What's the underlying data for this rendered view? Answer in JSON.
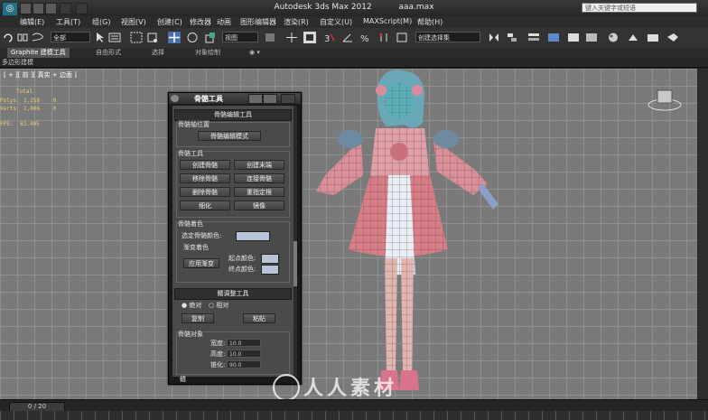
{
  "title_bar": {
    "app_title": "Autodesk 3ds Max  2012",
    "file_name": "aaa.max",
    "search_placeholder": "键入关键字或短语"
  },
  "menu": [
    "编辑(E)",
    "工具(T)",
    "组(G)",
    "视图(V)",
    "创建(C)",
    "修改器",
    "动画",
    "图形编辑器",
    "渲染(R)",
    "自定义(U)",
    "MAXScript(M)",
    "帮助(H)"
  ],
  "toolbar": {
    "selection_filter": "全部",
    "reference_coord": "视图",
    "named_selection": "创建选择集"
  },
  "ribbon": {
    "tabs": [
      "Graphite 建模工具",
      "自由形式",
      "选择",
      "对象绘制"
    ],
    "sub_label": "多边形建模"
  },
  "viewport": {
    "label": "[ + ][ 前 ][ 真实 + 边面 ]",
    "stats": [
      {
        "label": "Total",
        "value": ""
      },
      {
        "label": "Polys:",
        "value": "1,258    0"
      },
      {
        "label": "Verts:",
        "value": "1,006    0"
      },
      {
        "label": "FPS:",
        "value": "83.405"
      }
    ]
  },
  "bone_tools": {
    "title": "骨骼工具",
    "rollout_edit": "骨骼编辑工具",
    "group_pivot": "骨骼轴位置",
    "btn_edit_mode": "骨骼编辑模式",
    "group_tools": "骨骼工具",
    "btn_create_bone": "创建骨骼",
    "btn_create_end": "创建末端",
    "btn_remove_bone": "移除骨骼",
    "btn_connect_bone": "连接骨骼",
    "btn_delete_bone": "删除骨骼",
    "btn_reassign_root": "重指定根",
    "btn_refine": "细化",
    "btn_mirror": "镜像",
    "group_color": "骨骼着色",
    "label_selected_color": "选定骨骼颜色:",
    "group_gradient": "渐变着色",
    "btn_apply_gradient": "应用渐变",
    "label_start_color": "起点颜色:",
    "label_end_color": "终点颜色:",
    "rollout_fin": "鳍调整工具",
    "radio_absolute": "绝对",
    "radio_relative": "相对",
    "btn_copy": "复制",
    "btn_paste": "粘贴",
    "group_bone_object": "骨骼对象",
    "label_width": "宽度:",
    "label_height": "高度:",
    "label_taper": "锥化:",
    "val_width": "10.0",
    "val_height": "10.0",
    "val_taper": "90.0",
    "bottom_label": "鳍"
  },
  "timeline": {
    "frame": "0 / 20"
  },
  "watermark": "人人素材",
  "colors": {
    "selected_bone_color": "#b8c4d8",
    "start_color": "#b8c4d8",
    "end_color": "#b8c4d8"
  }
}
